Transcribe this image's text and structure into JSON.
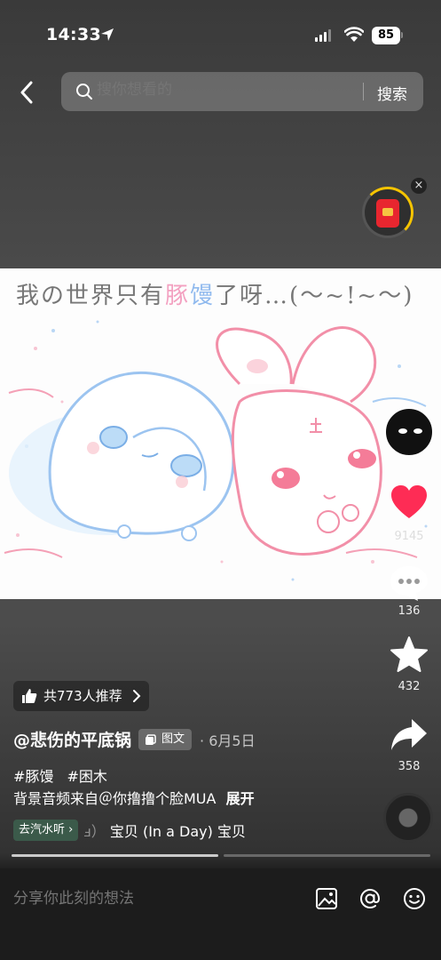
{
  "status_bar": {
    "time": "14:33",
    "battery": "85"
  },
  "search": {
    "placeholder": "搜你想看的",
    "button": "搜索"
  },
  "artwork": {
    "title_part1": "我の世界只有",
    "title_pink": "豚",
    "title_blue": "馒",
    "title_part2": "了呀…(～~!~～)"
  },
  "actions": {
    "likes": "9145",
    "comments": "136",
    "favorites": "432",
    "shares": "358"
  },
  "recommend": {
    "label": "共773人推荐"
  },
  "post": {
    "author": "@悲伤的平底锅",
    "type_badge": "图文",
    "date": "6月5日",
    "hashtags": [
      "#豚馒",
      "#困木"
    ],
    "bgm_text": "背景音频来自＠你撸撸个脸MUA",
    "expand": "展开"
  },
  "music": {
    "tag": "去汽水听 ›",
    "song_faded": "ⅎ）",
    "song": "宝贝 (In a Day) 宝贝"
  },
  "comment_box": {
    "placeholder": "分享你此刻的想法"
  },
  "icons": {
    "back": "chevron-left-icon",
    "search": "search-icon",
    "like": "heart-icon",
    "comment": "comment-bubble-icon",
    "favorite": "star-icon",
    "share": "share-arrow-icon",
    "image": "image-icon",
    "mention": "at-icon",
    "emoji": "emoji-icon"
  },
  "colors": {
    "like": "#fe2c55",
    "tag_bg": "#3b5a4a",
    "accent_yellow": "#f5c400"
  }
}
